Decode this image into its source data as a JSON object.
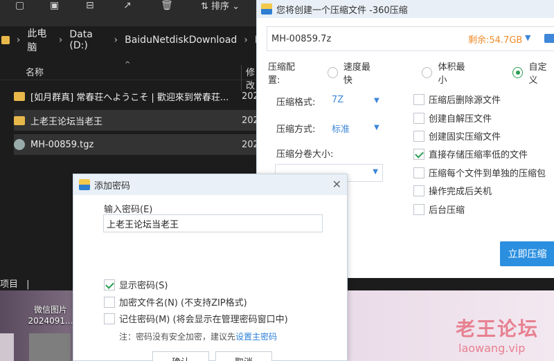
{
  "explorer": {
    "toolbar": {
      "sort_label": "排序"
    },
    "path": [
      "此电脑",
      "Data (D:)",
      "BaiduNetdiskDownload",
      "M"
    ],
    "columns": {
      "name": "名称",
      "modified": "修改"
    },
    "items": [
      {
        "name": "[如月群真] 常春荘へようこそ | 歡迎來到常春荘...",
        "date": "202"
      },
      {
        "name": "上老王论坛当老王",
        "date": "202"
      },
      {
        "name": "MH-00859.tgz",
        "date": "202"
      }
    ],
    "status": "项目"
  },
  "desktop": {
    "icon_label_line1": "微信图片",
    "icon_label_line2": "2024091..."
  },
  "compress_dialog": {
    "title": "您将创建一个压缩文件 -360压缩",
    "filename": "MH-00859.7z",
    "free_space": "剩余:54.7GB",
    "config_label": "压缩配置:",
    "modes": [
      "速度最快",
      "体积最小",
      "自定义"
    ],
    "format_label": "压缩格式:",
    "format_value": "7Z",
    "method_label": "压缩方式:",
    "method_value": "标准",
    "split_label": "压缩分卷大小:",
    "options": [
      {
        "label": "压缩后删除源文件",
        "checked": false
      },
      {
        "label": "创建自解压文件",
        "checked": false
      },
      {
        "label": "创建固实压缩文件",
        "checked": false
      },
      {
        "label": "直接存储压缩率低的文件",
        "checked": true
      },
      {
        "label": "压缩每个文件到单独的压缩包",
        "checked": false
      },
      {
        "label": "操作完成后关机",
        "checked": false
      },
      {
        "label": "后台压缩",
        "checked": false
      }
    ],
    "start_button": "立即压缩"
  },
  "password_dialog": {
    "title": "添加密码",
    "input_label": "输入密码(E)",
    "password_value": "上老王论坛当老王",
    "show_password": "显示密码(S)",
    "encrypt_names": "加密文件名(N) (不支持ZIP格式)",
    "remember": "记住密码(M) (将会显示在管理密码窗口中)",
    "note_prefix": "注：密码没有安全加密，建议先",
    "note_link": "设置主密码",
    "ok_button": "确认",
    "cancel_button": "取消"
  },
  "watermark": {
    "line1": "老王论坛",
    "line2": "laowang.vip"
  }
}
